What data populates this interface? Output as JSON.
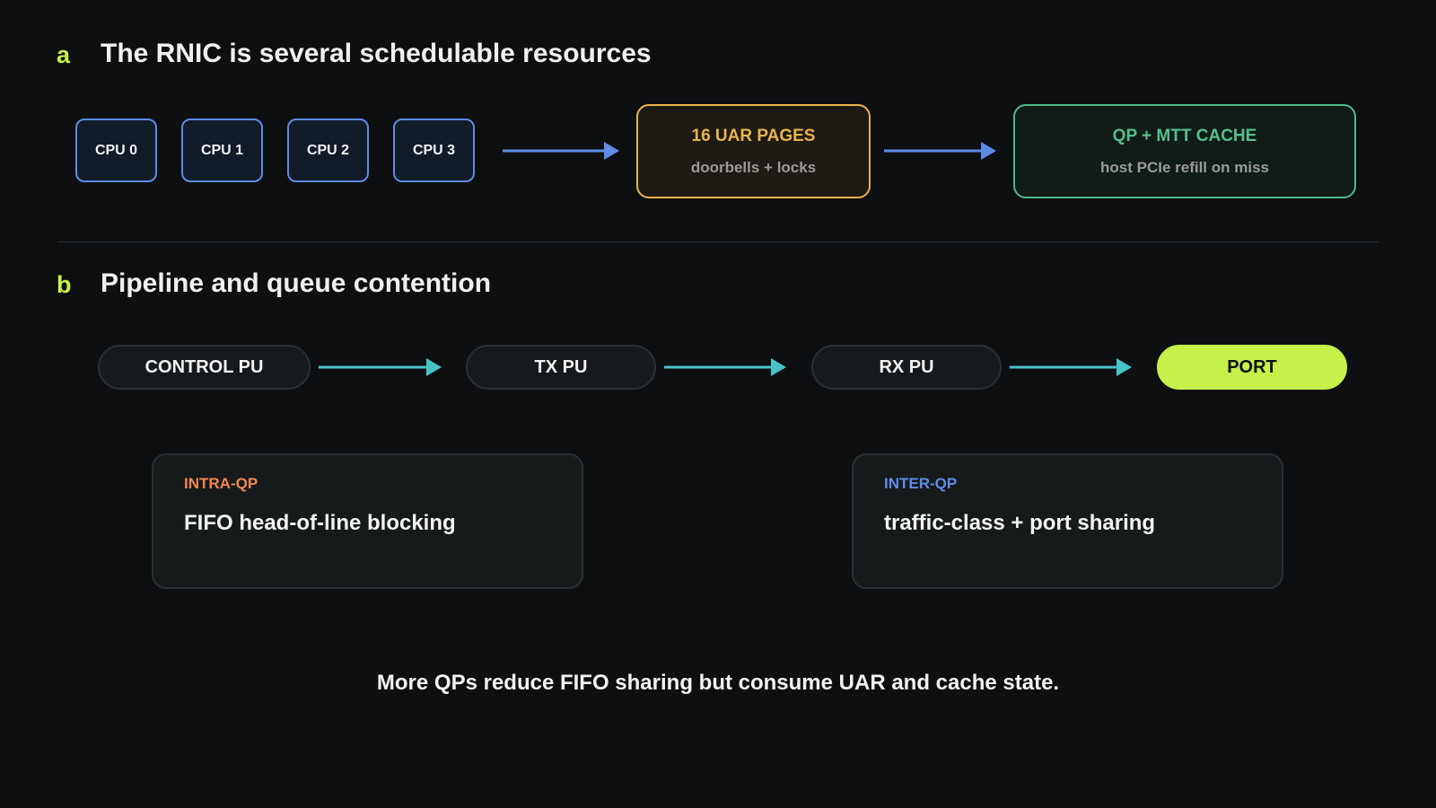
{
  "section_a": {
    "letter": "a",
    "title": "The RNIC is several schedulable resources",
    "cpus": [
      "CPU 0",
      "CPU 1",
      "CPU 2",
      "CPU 3"
    ],
    "uar": {
      "title": "16 UAR PAGES",
      "subtitle": "doorbells + locks"
    },
    "mtt": {
      "title": "QP + MTT CACHE",
      "subtitle": "host PCIe refill on miss"
    }
  },
  "section_b": {
    "letter": "b",
    "title": "Pipeline and queue contention",
    "pipeline": [
      "CONTROL PU",
      "TX PU",
      "RX PU",
      "PORT"
    ],
    "intra": {
      "tag": "INTRA-QP",
      "text": "FIFO head-of-line blocking"
    },
    "inter": {
      "tag": "INTER-QP",
      "text": "traffic-class + port sharing"
    }
  },
  "caption": "More QPs reduce FIFO sharing but consume UAR and cache state.",
  "colors": {
    "accent": "#c7f04a",
    "cpu_border": "#5f8be6",
    "uar": "#e9b44c",
    "mtt": "#4fb986",
    "pipeline_arrow": "#48c3c8",
    "resource_arrow": "#5f8be6",
    "intra": "#f0874f",
    "inter": "#5f8be6"
  }
}
